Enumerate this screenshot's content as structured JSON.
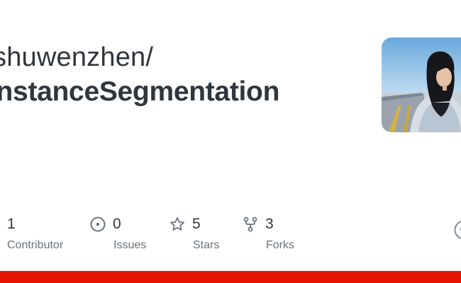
{
  "repo": {
    "owner_text": "shuwenzhen/",
    "name": "InstanceSegmentation"
  },
  "stats": {
    "contributors": {
      "value": "1",
      "label": "Contributor"
    },
    "issues": {
      "value": "0",
      "label": "Issues"
    },
    "stars": {
      "value": "5",
      "label": "Stars"
    },
    "forks": {
      "value": "3",
      "label": "Forks"
    }
  },
  "icons": {
    "issues": "issue-opened-icon",
    "stars": "star-icon",
    "forks": "repo-forked-icon",
    "corner": "github-logo-icon"
  },
  "colors": {
    "text_primary": "#2f363d",
    "text_secondary": "#6a737d",
    "language_bar": "#e51400"
  }
}
